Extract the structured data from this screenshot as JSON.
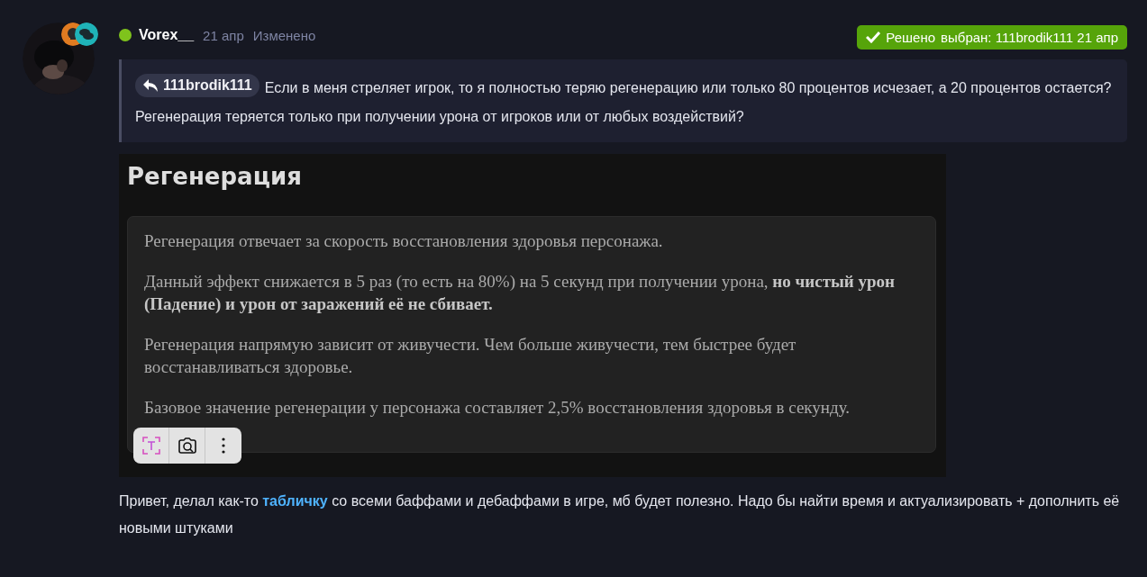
{
  "post": {
    "author": {
      "name": "Vorex__",
      "online": true
    },
    "date": "21 апр",
    "edited": "Изменено",
    "solution_badge": {
      "label": "Решено",
      "detail": "выбран: 111brodik111 21 апр"
    },
    "quote": {
      "author": "111brodik111",
      "lines": [
        "Если в меня стреляет игрок, то я полностью теряю регенерацию или только 80 процентов исчезает, а 20 процентов остается?",
        "Регенерация теряется только при получении урона от игроков или от любых воздействий?"
      ]
    },
    "embedded_screenshot": {
      "title": "Регенерация",
      "paragraphs": [
        "Регенерация отвечает за скорость восстановления здоровья персонажа.",
        "Данный эффект снижается в 5 раз (то есть на 80%) на 5 секунд при получении урона, **но чистый урон (Падение) и урон от заражений её не сбивает.**",
        "Регенерация напрямую зависит от живучести. Чем больше живучести, тем быстрее будет восстанавливаться здоровье.",
        "Базовое значение регенерации у персонажа составляет 2,5% восстановления здоровья в секунду."
      ]
    },
    "body": {
      "before": "Привет, делал как-то ",
      "link": "табличку",
      "after": " со всеми баффами и дебаффами в игре, мб будет полезно. Надо бы найти время и актуализировать + дополнить её новыми штуками"
    }
  }
}
